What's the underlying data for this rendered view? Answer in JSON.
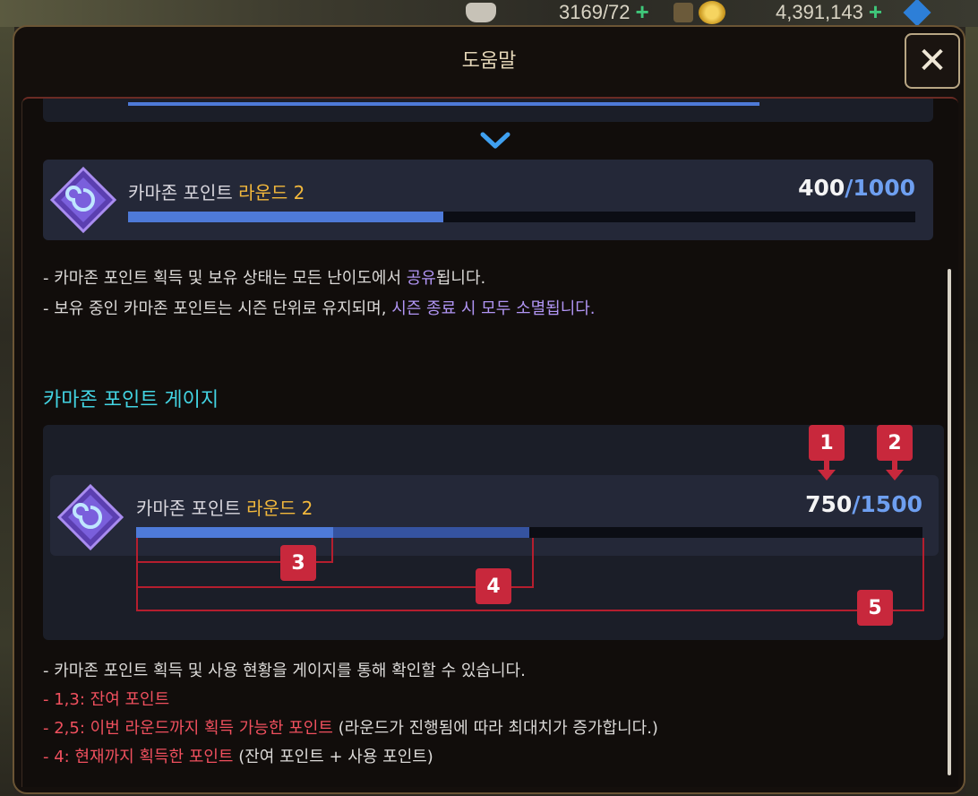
{
  "hud": {
    "stamina_value": "3169/72",
    "gold_value": "4,391,143",
    "plus": "+"
  },
  "dialog": {
    "title": "도움말",
    "close_icon": "✕"
  },
  "top_card": {
    "label_prefix": "카마존 포인트 ",
    "label_highlight": "라운드 2",
    "current": "400",
    "max": "/1000",
    "progress": 0.4
  },
  "shared_notes": [
    {
      "before": "- 카마존 포인트 획득 및 보유 상태는 모든 난이도에서 ",
      "highlight": "공유",
      "after": "됩니다."
    },
    {
      "before": "- 보유 중인 카마존 포인트는 시즌 단위로 유지되며, ",
      "highlight": "시즌 종료 시 모두 소멸됩니다.",
      "after": ""
    }
  ],
  "gauge_section": {
    "title": "카마존 포인트 게이지",
    "card": {
      "label_prefix": "카마존 포인트 ",
      "label_highlight": "라운드 2",
      "current": "750",
      "max": "/1500",
      "remaining_fraction": 0.25,
      "earned_fraction": 0.5
    },
    "markers": [
      "1",
      "2",
      "3",
      "4",
      "5"
    ]
  },
  "gauge_notes": [
    {
      "red": "",
      "rest": "- 카마존 포인트 획득 및 사용 현황을 게이지를 통해 확인할 수 있습니다."
    },
    {
      "red": "- 1,3: 잔여 포인트",
      "rest": ""
    },
    {
      "red": "- 2,5: 이번 라운드까지 획득 가능한 포인트",
      "rest": " (라운드가 진행됨에 따라 최대치가 증가합니다.)"
    },
    {
      "red": "- 4: 현재까지 획득한 포인트",
      "rest": " (잔여 포인트 + 사용 포인트)"
    }
  ],
  "colors": {
    "accent_blue": "#4e7ad8",
    "highlight_yellow": "#f2b83c",
    "section_cyan": "#43d4e3",
    "note_purple": "#b195f4",
    "note_red": "#f0505e",
    "marker_red": "#c8283c"
  }
}
